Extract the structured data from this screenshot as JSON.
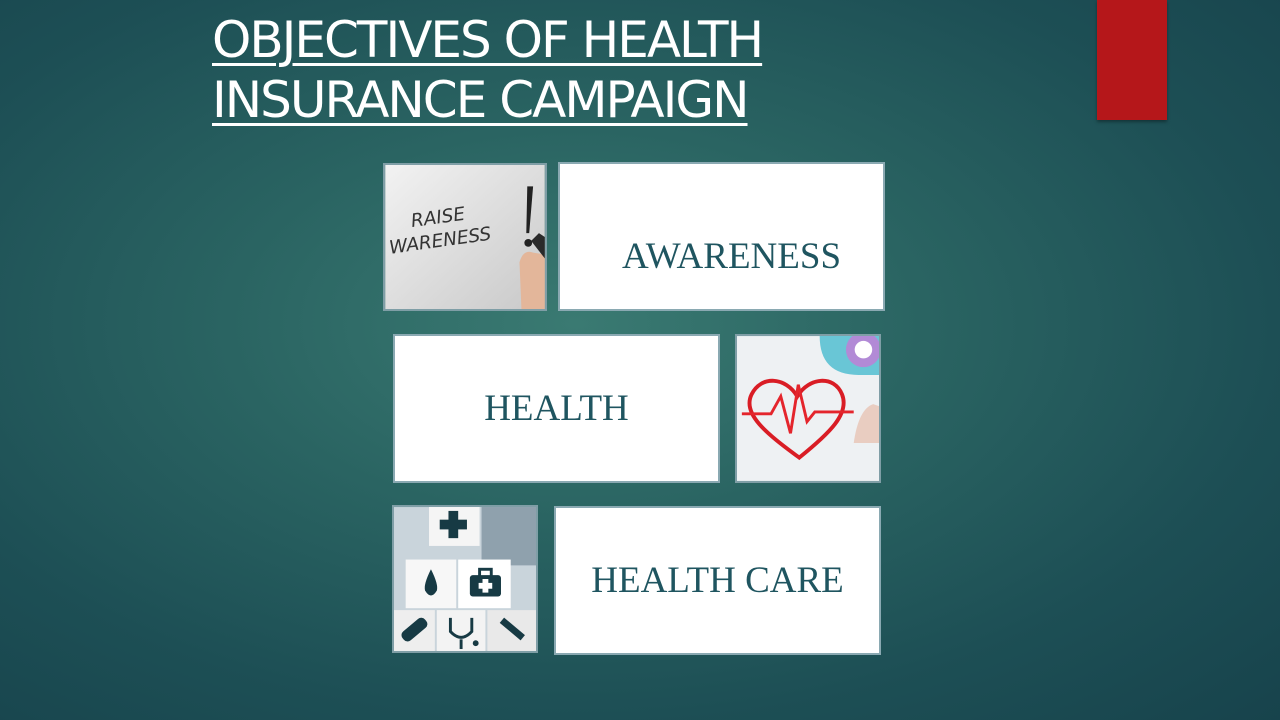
{
  "slide": {
    "title_line1": "OBJECTIVES OF HEALTH",
    "title_line2": "INSURANCE CAMPAIGN"
  },
  "tiles": [
    {
      "label": "AWARENESS"
    },
    {
      "label": "HEALTH"
    },
    {
      "label": "HEALTH CARE"
    }
  ],
  "images": {
    "raise_awareness_text_line1": "RAISE",
    "raise_awareness_text_line2": "WARENESS"
  },
  "colors": {
    "background": "#2a6462",
    "accent_red": "#b5171a",
    "tile_text": "#1f5560"
  }
}
